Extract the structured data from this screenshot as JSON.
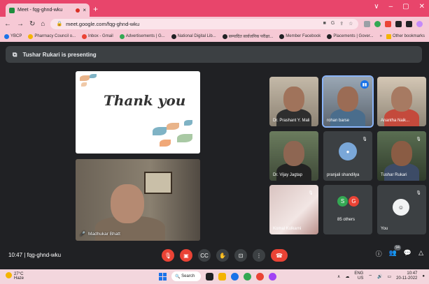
{
  "browser": {
    "tab_title": "Meet - fqg-ghnd-wku",
    "tab_close": "×",
    "new_tab": "+",
    "url": "meet.google.com/fqg-ghnd-wku",
    "window_controls": [
      "∨",
      "–",
      "▢",
      "✕"
    ]
  },
  "bookmarks": [
    {
      "label": "YBCP",
      "color": "#1a73e8"
    },
    {
      "label": "Pharmacy Council o...",
      "color": "#f4b400"
    },
    {
      "label": "Inbox - Gmail",
      "color": "#ea4335"
    },
    {
      "label": "Advertisements | G...",
      "color": "#34a853"
    },
    {
      "label": "National Digital Lib...",
      "color": "#202124"
    },
    {
      "label": "सम्पादित सार्वजनिक परीक्षा...",
      "color": "#202124"
    },
    {
      "label": "Member Facebook",
      "color": "#202124"
    },
    {
      "label": "Placements | Gover...",
      "color": "#202124"
    }
  ],
  "bookmarks_right": "Other bookmarks",
  "meeting": {
    "presenting_banner": "Tushar Rukari is presenting",
    "slide_text": "Thank you",
    "main_speaker_name": "Madhukar Bhatt",
    "time": "10:47",
    "separator": "|",
    "meeting_code": "fqg-ghnd-wku",
    "participants": [
      {
        "name": "Dr. Prashant Y. Mali"
      },
      {
        "name": "rohan barse"
      },
      {
        "name": "Anantha Naik..."
      },
      {
        "name": "Dr. Vijay Jagtap"
      },
      {
        "name": "pranjali shandilya"
      },
      {
        "name": "Tushar Rukari"
      },
      {
        "name": "Komal Kulkarni"
      },
      {
        "name": "85 others"
      },
      {
        "name": "You"
      }
    ],
    "others_avatars": [
      "S",
      "G"
    ],
    "people_count": "94"
  },
  "taskbar": {
    "temperature": "27°C",
    "condition": "Haze",
    "search_label": "Search",
    "lang": "ENG",
    "region": "US",
    "clock_time": "10:47",
    "date": "20-11-2022"
  }
}
